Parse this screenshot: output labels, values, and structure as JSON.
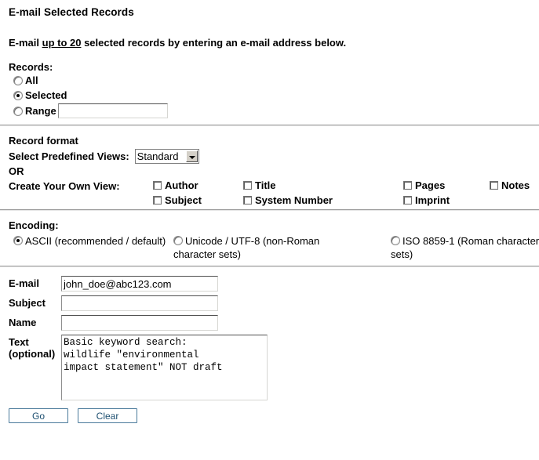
{
  "page": {
    "title": "E-mail Selected Records",
    "intro_prefix": "E-mail ",
    "intro_link": "up to 20",
    "intro_suffix": " selected records by entering an e-mail address below."
  },
  "records": {
    "label": "Records:",
    "selected_value": "Selected",
    "options": [
      {
        "label": "All",
        "value": "all",
        "checked": false
      },
      {
        "label": "Selected",
        "value": "selected",
        "checked": true
      },
      {
        "label": "Range",
        "value": "range",
        "checked": false
      }
    ],
    "range_input_value": "",
    "range_input_placeholder": ""
  },
  "record_format": {
    "heading": "Record format",
    "predefined_label": "Select Predefined Views:",
    "predefined_selected": "Standard",
    "predefined_options": [
      "Standard"
    ],
    "or_text": "OR",
    "own_view_label": "Create Your Own View:",
    "checkboxes": [
      {
        "label": "Author",
        "checked": false
      },
      {
        "label": "Title",
        "checked": false
      },
      {
        "label": "Pages",
        "checked": false
      },
      {
        "label": "Notes",
        "checked": false
      },
      {
        "label": "Subject",
        "checked": false
      },
      {
        "label": "System Number",
        "checked": false
      },
      {
        "label": "Imprint",
        "checked": false
      }
    ]
  },
  "encoding": {
    "label": "Encoding:",
    "options": [
      {
        "label": "ASCII (recommended / default)",
        "checked": true
      },
      {
        "label": "Unicode / UTF-8 (non-Roman character sets)",
        "checked": false
      },
      {
        "label": "ISO 8859-1 (Roman character sets)",
        "checked": false
      }
    ]
  },
  "form": {
    "email_label": "E-mail",
    "email_value": "john_doe@abc123.com",
    "subject_label": "Subject",
    "subject_value": "",
    "name_label": "Name",
    "name_value": "",
    "text_label_line1": "Text",
    "text_label_line2": "(optional)",
    "text_value": "Basic keyword search:\nwildlife \"environmental\nimpact statement\" NOT draft"
  },
  "buttons": {
    "go": "Go",
    "clear": "Clear"
  },
  "colors": {
    "button_border": "#4a7a9b",
    "button_text": "#1d4f70",
    "separator": "#9b9b9b"
  }
}
